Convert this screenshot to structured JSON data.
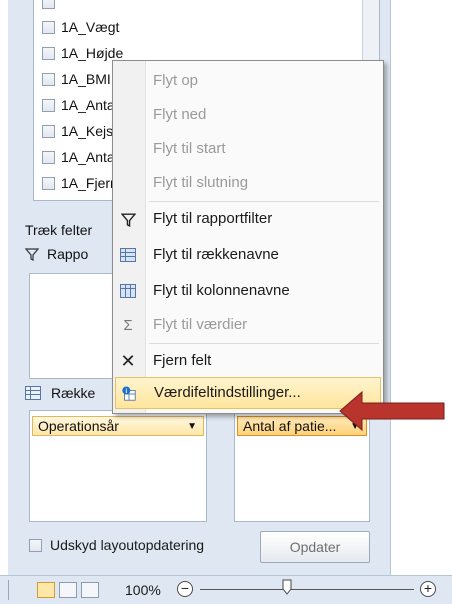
{
  "field_list": {
    "items": [
      {
        "label": "1A_Vægt",
        "checked": false
      },
      {
        "label": "1A_Højde",
        "checked": false
      },
      {
        "label": "1A_BMI",
        "checked": false
      },
      {
        "label": "1A_Anta",
        "checked": false
      },
      {
        "label": "1A_Kejs",
        "checked": false
      },
      {
        "label": "1A_Anta",
        "checked": false
      },
      {
        "label": "1A_Fjern",
        "checked": false
      }
    ]
  },
  "sections": {
    "drag_fields_label": "Træk felter",
    "report_filter_label": "Rappo",
    "row_labels_label": "Række"
  },
  "chips": {
    "rows_chip": "Operationsår",
    "values_chip": "Antal af patie..."
  },
  "context_menu": {
    "items": [
      {
        "label": "Flyt op",
        "enabled": false,
        "icon": ""
      },
      {
        "label": "Flyt ned",
        "enabled": false,
        "icon": ""
      },
      {
        "label": "Flyt til start",
        "enabled": false,
        "icon": ""
      },
      {
        "label": "Flyt til slutning",
        "enabled": false,
        "icon": ""
      },
      {
        "label": "Flyt til rapportfilter",
        "enabled": true,
        "icon": "filter-icon"
      },
      {
        "label": "Flyt til rækkenavne",
        "enabled": true,
        "icon": "row-labels-icon"
      },
      {
        "label": "Flyt til kolonnenavne",
        "enabled": true,
        "icon": "column-labels-icon"
      },
      {
        "label": "Flyt til værdier",
        "enabled": false,
        "icon": "sigma-icon"
      },
      {
        "label": "Fjern felt",
        "enabled": true,
        "icon": "remove-icon"
      },
      {
        "label": "Værdifeltindstillinger...",
        "enabled": true,
        "icon": "value-field-settings-icon",
        "hovered": true
      }
    ]
  },
  "footer": {
    "defer_layout_label": "Udskyd layoutopdatering",
    "update_button_label": "Opdater"
  },
  "statusbar": {
    "zoom_level": "100%",
    "zoom_out": "−",
    "zoom_in": "+"
  },
  "colors": {
    "panel_bg": "#dfe7f2",
    "chip_highlight": "#ffe7a8",
    "annotation_arrow": "#b8342c"
  }
}
